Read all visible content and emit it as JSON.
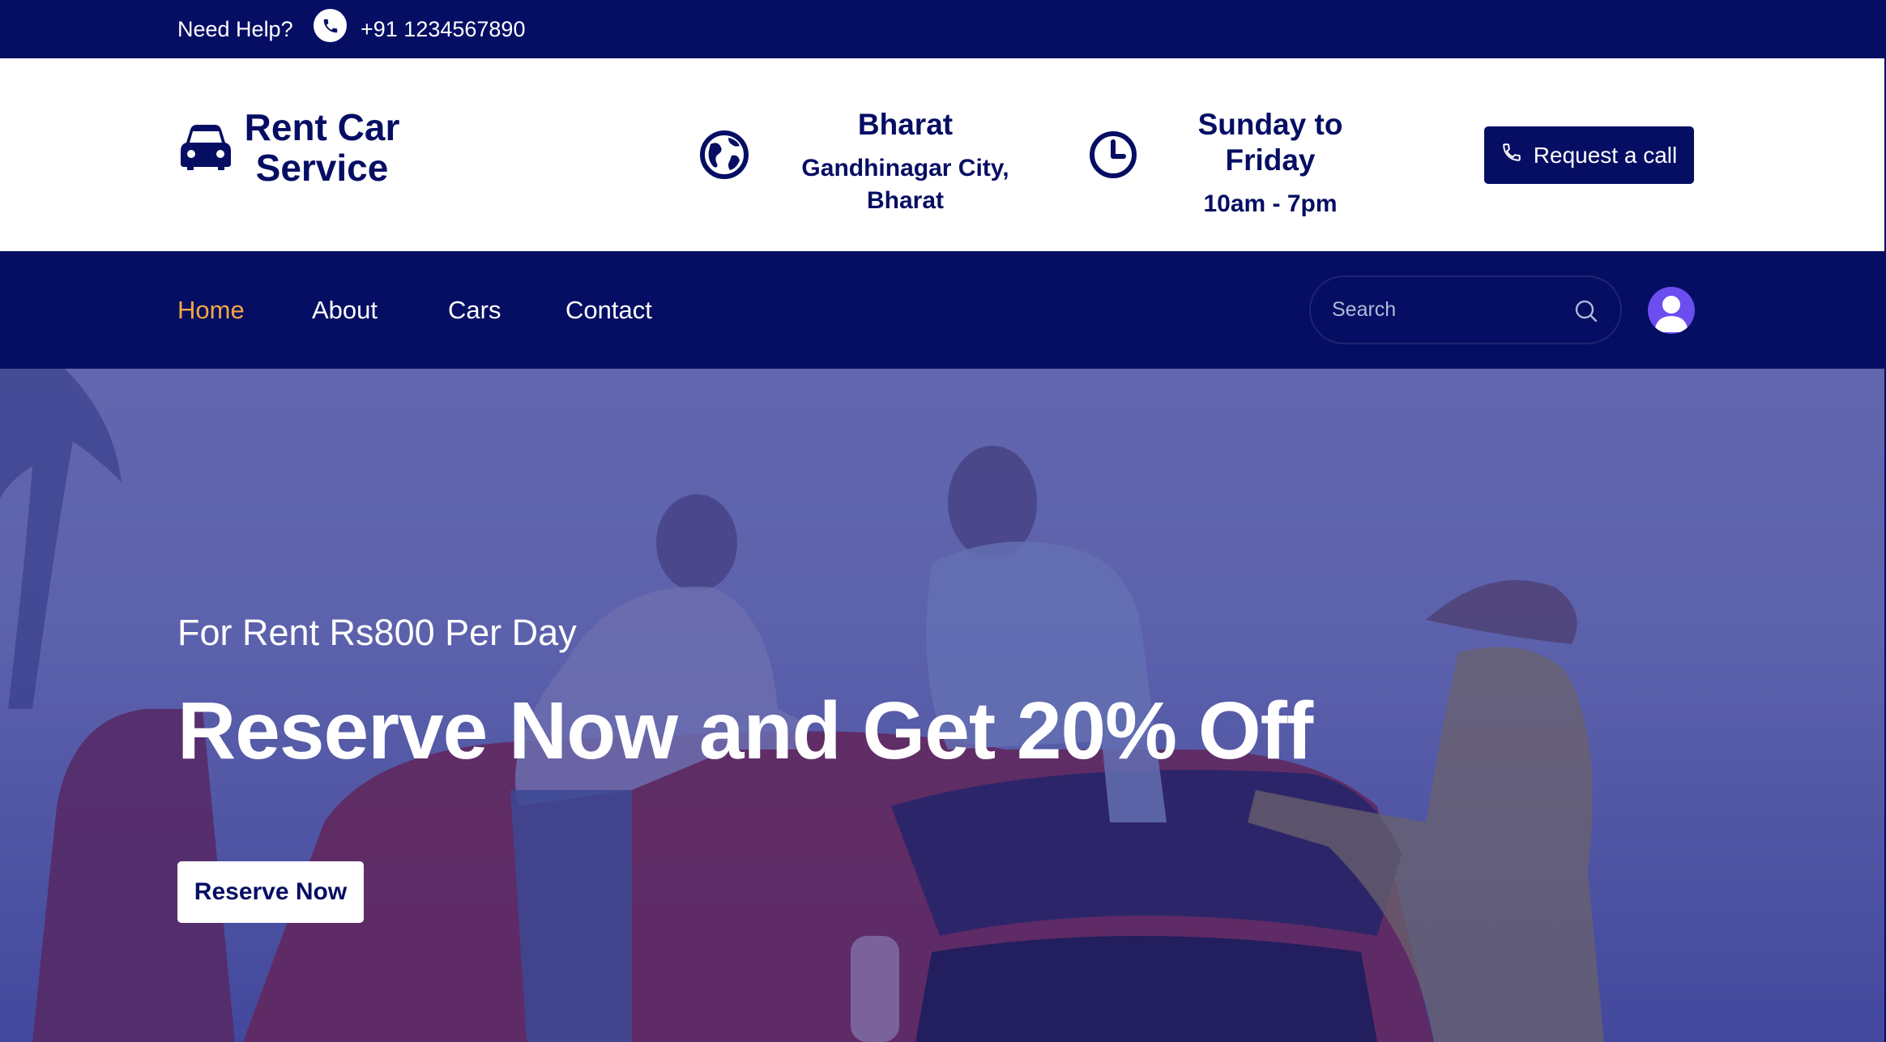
{
  "topbar": {
    "help_label": "Need Help?",
    "phone": "+91 1234567890"
  },
  "brand": {
    "name_line1": "Rent Car",
    "name_line2": "Service"
  },
  "location": {
    "title": "Bharat",
    "subtitle": "Gandhinagar City, Bharat"
  },
  "hours": {
    "title": "Sunday to Friday",
    "subtitle": "10am - 7pm"
  },
  "cta": {
    "request_call_label": "Request a call"
  },
  "nav": {
    "items": [
      {
        "label": "Home",
        "active": true
      },
      {
        "label": "About",
        "active": false
      },
      {
        "label": "Cars",
        "active": false
      },
      {
        "label": "Contact",
        "active": false
      }
    ],
    "search_placeholder": "Search"
  },
  "hero": {
    "subtitle": "For Rent Rs800 Per Day",
    "title": "Reserve Now and Get 20% Off",
    "button_label": "Reserve Now"
  },
  "colors": {
    "navy": "#050e63",
    "accent": "#f4a640",
    "avatar": "#6c4df0"
  }
}
